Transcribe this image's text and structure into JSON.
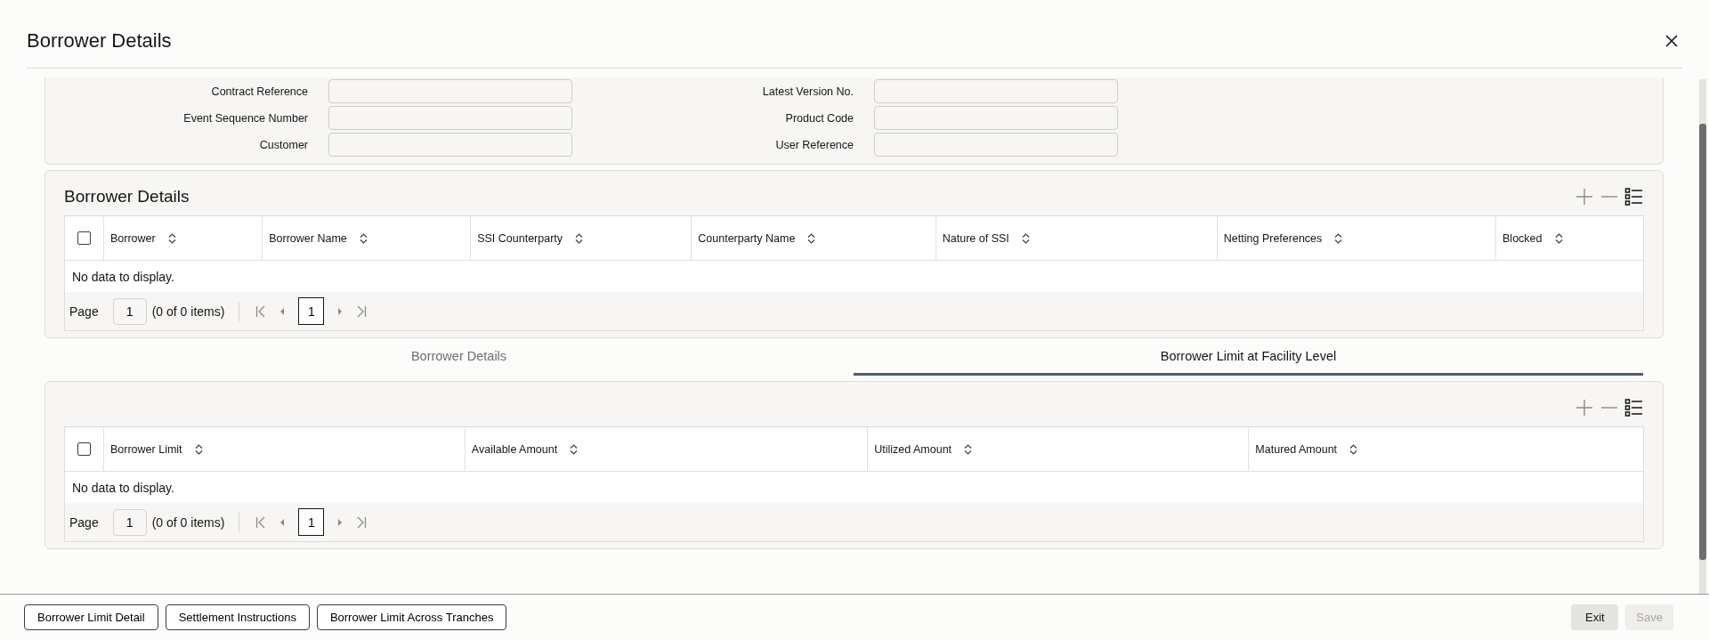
{
  "dialog": {
    "title": "Borrower Details"
  },
  "header_fields": [
    {
      "label": "Contract Reference"
    },
    {
      "label": "Latest Version No."
    },
    {
      "label": "Event Sequence Number"
    },
    {
      "label": "Product Code"
    },
    {
      "label": "Customer"
    },
    {
      "label": "User Reference"
    }
  ],
  "borrower_details": {
    "title": "Borrower Details",
    "select_all_checked": false,
    "columns": [
      "Borrower",
      "Borrower Name",
      "SSI Counterparty",
      "Counterparty Name",
      "Nature of SSI",
      "Netting Preferences",
      "Blocked"
    ],
    "empty_text": "No data to display.",
    "pager": {
      "label": "Page",
      "page": "1",
      "summary": "(0 of 0 items)",
      "current": "1"
    }
  },
  "tabs": [
    {
      "label": "Borrower Details",
      "selected": false
    },
    {
      "label": "Borrower Limit at Facility Level",
      "selected": true
    }
  ],
  "limit_table": {
    "select_all_checked": false,
    "columns": [
      "Borrower Limit",
      "Available Amount",
      "Utilized Amount",
      "Matured Amount"
    ],
    "empty_text": "No data to display.",
    "pager": {
      "label": "Page",
      "page": "1",
      "summary": "(0 of 0 items)",
      "current": "1"
    }
  },
  "footer": {
    "buttons": [
      "Borrower Limit Detail",
      "Settlement Instructions",
      "Borrower Limit Across Tranches"
    ],
    "actions": [
      {
        "label": "Exit",
        "disabled": false
      },
      {
        "label": "Save",
        "disabled": true
      }
    ]
  }
}
